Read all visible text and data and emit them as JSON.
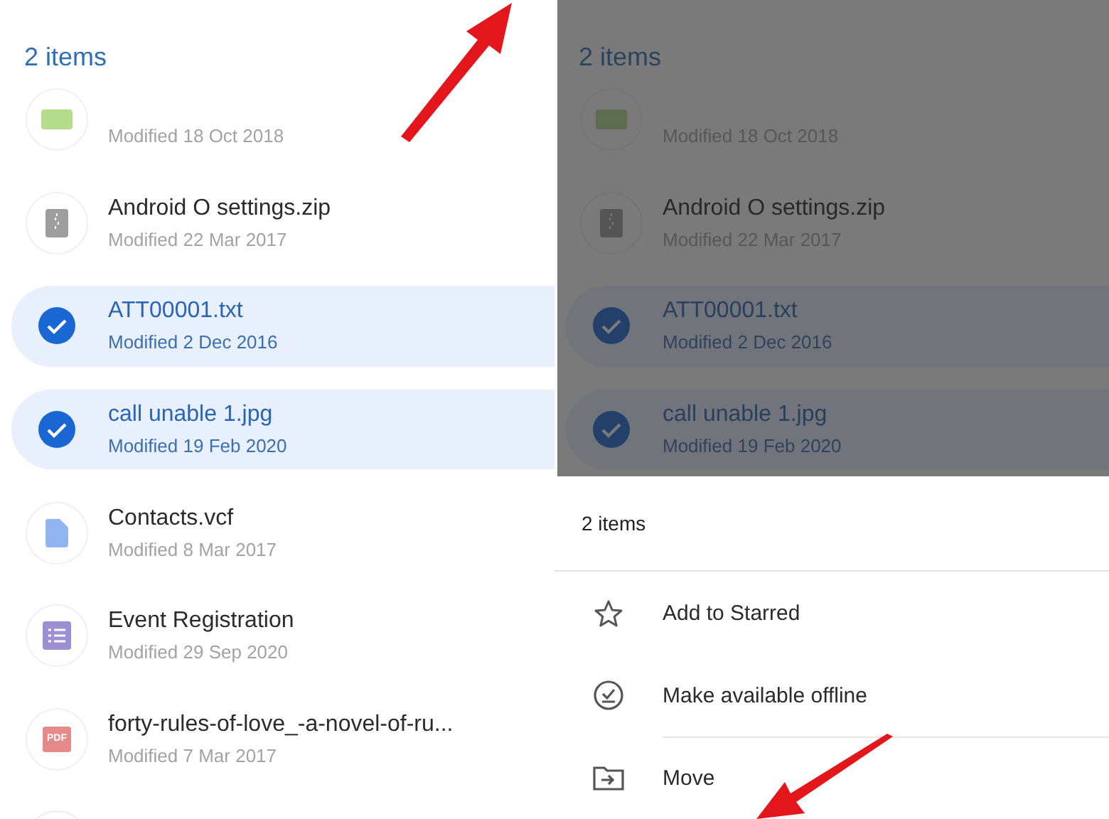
{
  "panels": [
    {
      "header": "2 items",
      "overlay": false,
      "files": [
        {
          "kind": "image",
          "modified": "Modified 18 Oct 2018",
          "selected": false
        },
        {
          "kind": "zip",
          "name": "Android O settings.zip",
          "modified": "Modified 22 Mar 2017",
          "selected": false
        },
        {
          "name": "ATT00001.txt",
          "modified": "Modified 2 Dec 2016",
          "selected": true
        },
        {
          "name": "call unable 1.jpg",
          "modified": "Modified 19 Feb 2020",
          "selected": true
        },
        {
          "kind": "doc",
          "name": "Contacts.vcf",
          "modified": "Modified 8 Mar 2017",
          "selected": false
        },
        {
          "kind": "form",
          "name": "Event Registration",
          "modified": "Modified 29 Sep 2020",
          "selected": false
        },
        {
          "kind": "pdf",
          "badge": "PDF",
          "name": "forty-rules-of-love_-a-novel-of-ru...",
          "modified": "Modified 7 Mar 2017",
          "selected": false
        },
        {
          "kind": "blank",
          "selected": false
        }
      ],
      "arrows": [
        {
          "kind": "up-right"
        }
      ]
    },
    {
      "header": "2 items",
      "overlay": true,
      "files": [
        {
          "kind": "image",
          "modified": "Modified 18 Oct 2018",
          "selected": false
        },
        {
          "kind": "zip",
          "name": "Android O settings.zip",
          "modified": "Modified 22 Mar 2017",
          "selected": false
        },
        {
          "name": "ATT00001.txt",
          "modified": "Modified 2 Dec 2016",
          "selected": true
        },
        {
          "name": "call unable 1.jpg",
          "modified": "Modified 19 Feb 2020",
          "selected": true
        }
      ],
      "sheet": {
        "title": "2 items",
        "actions": [
          {
            "kind": "star",
            "label": "Add to Starred"
          },
          {
            "kind": "offline",
            "label": "Make available offline"
          },
          {
            "kind": "move",
            "label": "Move"
          }
        ]
      },
      "arrows": [
        {
          "kind": "down-left"
        }
      ]
    }
  ]
}
